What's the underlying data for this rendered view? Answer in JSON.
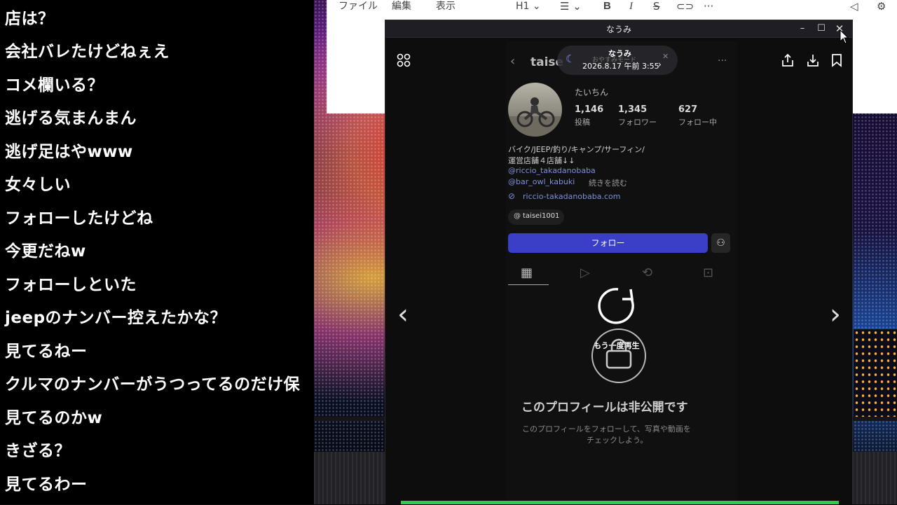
{
  "comments": [
    "店は？",
    "会社バレたけどねぇえ",
    "コメ欄いる？",
    "逃げる気まんまん",
    "逃げ足はやwww",
    "女々しい",
    "フォローしたけどね",
    "今更だねw",
    "フォローしといた",
    "jeepのナンバー控えたかな？",
    "見てるねー",
    "クルマのナンバーがうつってるのだけ保",
    "見てるのかw",
    "きざる？",
    "見てるわー"
  ],
  "editor": {
    "menu": [
      "ファイル",
      "編集",
      "表示"
    ],
    "heading_label": "H1"
  },
  "window": {
    "title": "なうみ"
  },
  "viewer": {
    "overlay_title": "なうみ",
    "overlay_date": "2026.8.17 午前 3:55",
    "overlay_hidden_text": "おやすみモード"
  },
  "profile": {
    "username_partial": "taise",
    "display_name": "たいちん",
    "stats": [
      {
        "value": "1,146",
        "label": "投稿"
      },
      {
        "value": "1,345",
        "label": "フォロワー"
      },
      {
        "value": "627",
        "label": "フォロー中"
      }
    ],
    "bio_line1": "バイク/JEEP/釣り/キャンプ/サーフィン/",
    "bio_line2": "運営店舗４店舗↓↓",
    "mention1": "@riccio_takadanobaba",
    "mention2": "@bar_owl_kabuki",
    "read_more": "続きを読む",
    "website": "riccio-takadanobaba.com",
    "threads_handle": "taisei1001",
    "follow_label": "フォロー",
    "replay_label": "もう一度再生",
    "private_title": "このプロフィールは非公開です",
    "private_desc1": "このプロフィールをフォローして、写真や動画を",
    "private_desc2": "チェックしよう。"
  },
  "colors": {
    "follow_button": "#3b3fc8",
    "progress": "#2ecc4a",
    "link": "#7f8fd9"
  },
  "icons": [
    "grid-icon",
    "share-icon",
    "download-icon",
    "bookmark-icon",
    "replay-icon",
    "lock-icon",
    "chevron-left-icon",
    "chevron-right-icon",
    "close-icon",
    "minimize-icon",
    "maximize-icon"
  ]
}
